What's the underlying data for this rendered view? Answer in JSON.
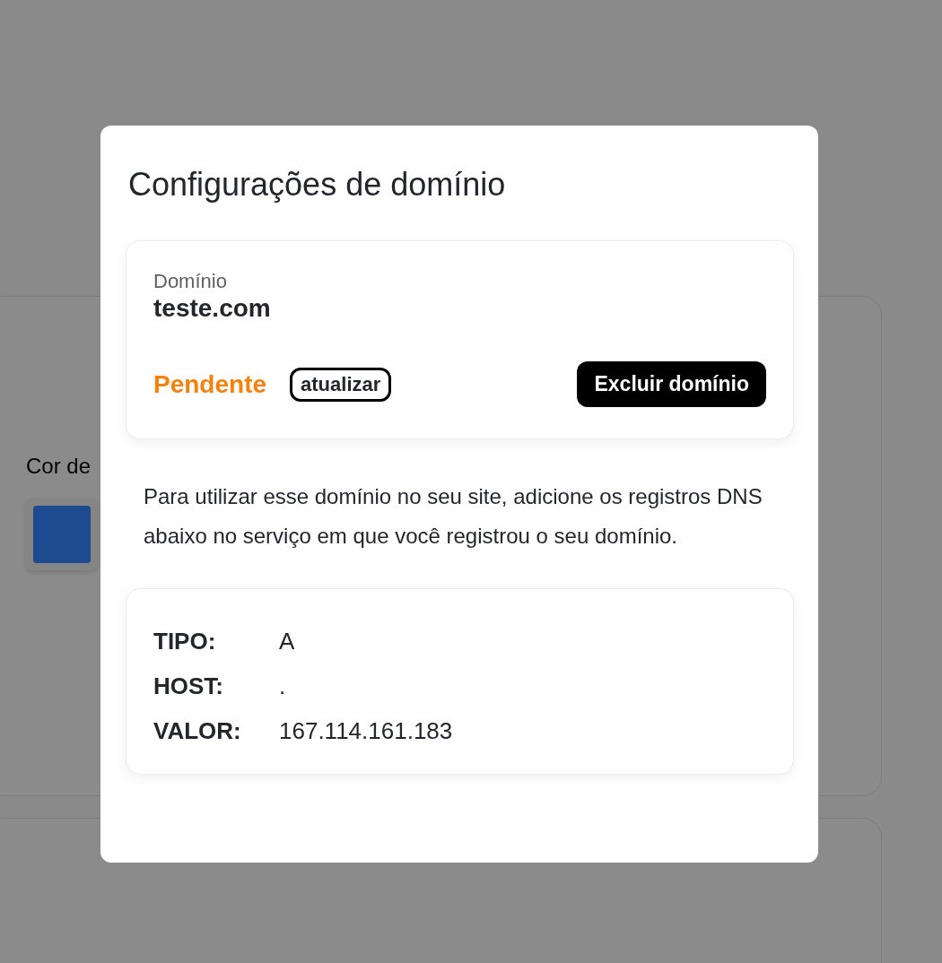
{
  "background": {
    "color_label": "Cor de",
    "color_swatch": {
      "color": "#1e4a8f"
    }
  },
  "dialog": {
    "title": "Configurações de domínio",
    "domain_card": {
      "label": "Domínio",
      "value": "teste.com",
      "status": {
        "label": "Pendente",
        "kind": "pending"
      },
      "refresh_button": "atualizar",
      "delete_button": "Excluir domínio"
    },
    "instructions": "Para utilizar esse domínio no seu site, adicione os registros DNS abaixo no serviço em que você registrou o seu domínio.",
    "dns_records": [
      {
        "field": "TIPO:",
        "value": "A"
      },
      {
        "field": "HOST:",
        "value": "."
      },
      {
        "field": "VALOR:",
        "value": "167.114.161.183"
      }
    ]
  }
}
